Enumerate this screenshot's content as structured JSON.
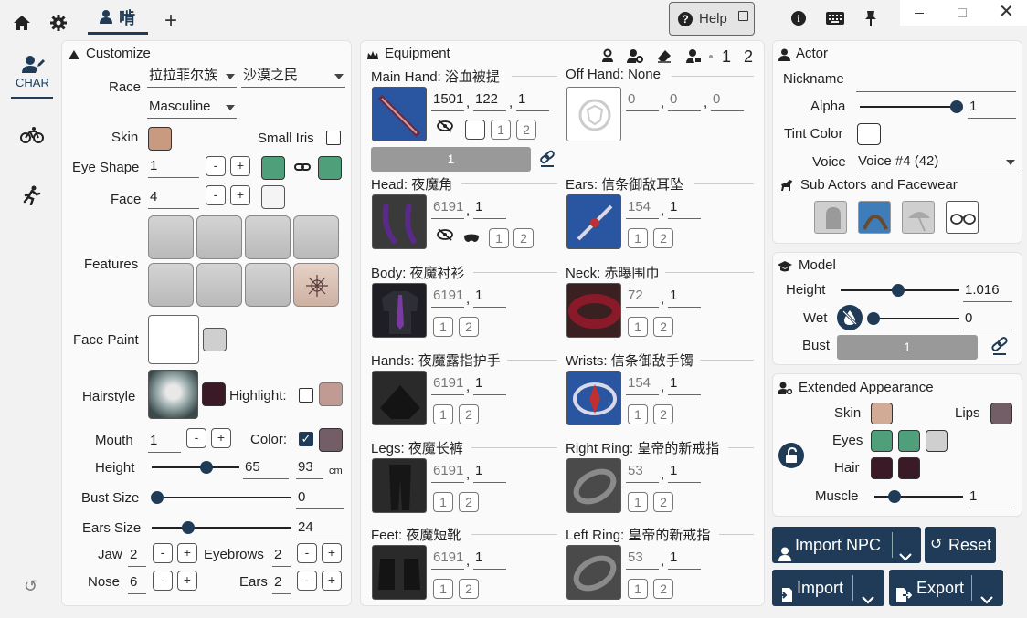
{
  "topbar": {
    "tab_label": "啃",
    "help": "Help"
  },
  "sidenav": {
    "char": "CHAR"
  },
  "customize": {
    "title": "Customize",
    "race_label": "Race",
    "race_value": "拉拉菲尔族",
    "clan_value": "沙漠之民",
    "gender_value": "Masculine",
    "skin_label": "Skin",
    "small_iris_label": "Small Iris",
    "eye_shape_label": "Eye Shape",
    "eye_shape_value": "1",
    "face_label": "Face",
    "face_value": "4",
    "features_label": "Features",
    "face_paint_label": "Face Paint",
    "hairstyle_label": "Hairstyle",
    "highlight_label": "Highlight:",
    "mouth_label": "Mouth",
    "mouth_value": "1",
    "color_label": "Color:",
    "height_label": "Height",
    "height_value": "65",
    "height_cm": "93",
    "cm": "cm",
    "bust_label": "Bust Size",
    "bust_value": "0",
    "ears_label": "Ears Size",
    "ears_value": "24",
    "jaw_label": "Jaw",
    "jaw_value": "2",
    "eyebrows_label": "Eyebrows",
    "eyebrows_value": "2",
    "nose_label": "Nose",
    "nose_value": "6",
    "ears2_label": "Ears",
    "ears2_value": "2",
    "minus": "-",
    "plus": "+",
    "skin_color": "#c99a80",
    "eye_color": "#4fa07a",
    "hair_color": "#3a1a26",
    "highlight_color": "#c29a94",
    "lip_color": "#735d66"
  },
  "equipment": {
    "title": "Equipment",
    "n1": "1",
    "n2": "2",
    "main_hand": {
      "label": "Main Hand: 浴血被提",
      "v1": "1501",
      "v2": "122",
      "v3": "1"
    },
    "main_bar": "1",
    "off_hand": {
      "label": "Off Hand: None",
      "v1": "0",
      "v2": "0",
      "v3": "0"
    },
    "head": {
      "label": "Head: 夜魔角",
      "v1": "6191",
      "v2": "1"
    },
    "ears": {
      "label": "Ears: 信条御敌耳坠",
      "v1": "154",
      "v2": "1"
    },
    "body": {
      "label": "Body: 夜魔衬衫",
      "v1": "6191",
      "v2": "1"
    },
    "neck": {
      "label": "Neck: 赤曝围巾",
      "v1": "72",
      "v2": "1"
    },
    "hands": {
      "label": "Hands: 夜魔露指护手",
      "v1": "6191",
      "v2": "1"
    },
    "wrists": {
      "label": "Wrists: 信条御敌手镯",
      "v1": "154",
      "v2": "1"
    },
    "legs": {
      "label": "Legs: 夜魔长裤",
      "v1": "6191",
      "v2": "1"
    },
    "right_ring": {
      "label": "Right Ring: 皇帝的新戒指",
      "v1": "53",
      "v2": "1"
    },
    "feet": {
      "label": "Feet: 夜魔短靴",
      "v1": "6191",
      "v2": "1"
    },
    "left_ring": {
      "label": "Left Ring: 皇帝的新戒指",
      "v1": "53",
      "v2": "1"
    },
    "sep": ",",
    "dye1": "1",
    "dye2": "2"
  },
  "actor": {
    "title": "Actor",
    "nickname_label": "Nickname",
    "alpha_label": "Alpha",
    "alpha_value": "1",
    "tint_label": "Tint Color",
    "voice_label": "Voice",
    "voice_value": "Voice #4 (42)",
    "sub_title": "Sub Actors and Facewear"
  },
  "model": {
    "title": "Model",
    "height_label": "Height",
    "height_value": "1.016",
    "wet_label": "Wet",
    "wet_value": "0",
    "bust_label": "Bust",
    "bust_value": "1"
  },
  "extended": {
    "title": "Extended Appearance",
    "skin_label": "Skin",
    "lips_label": "Lips",
    "eyes_label": "Eyes",
    "hair_label": "Hair",
    "muscle_label": "Muscle",
    "muscle_value": "1",
    "skin_color": "#d2ab97",
    "lips_color": "#735d66",
    "eye1": "#4fa07a",
    "eye2": "#4fa07a",
    "eye3": "#cfcfcf",
    "hair1": "#3a1a26",
    "hair2": "#3a1a26"
  },
  "buttons": {
    "import_npc": "Import NPC",
    "reset": "Reset",
    "import": "Import",
    "export": "Export"
  }
}
